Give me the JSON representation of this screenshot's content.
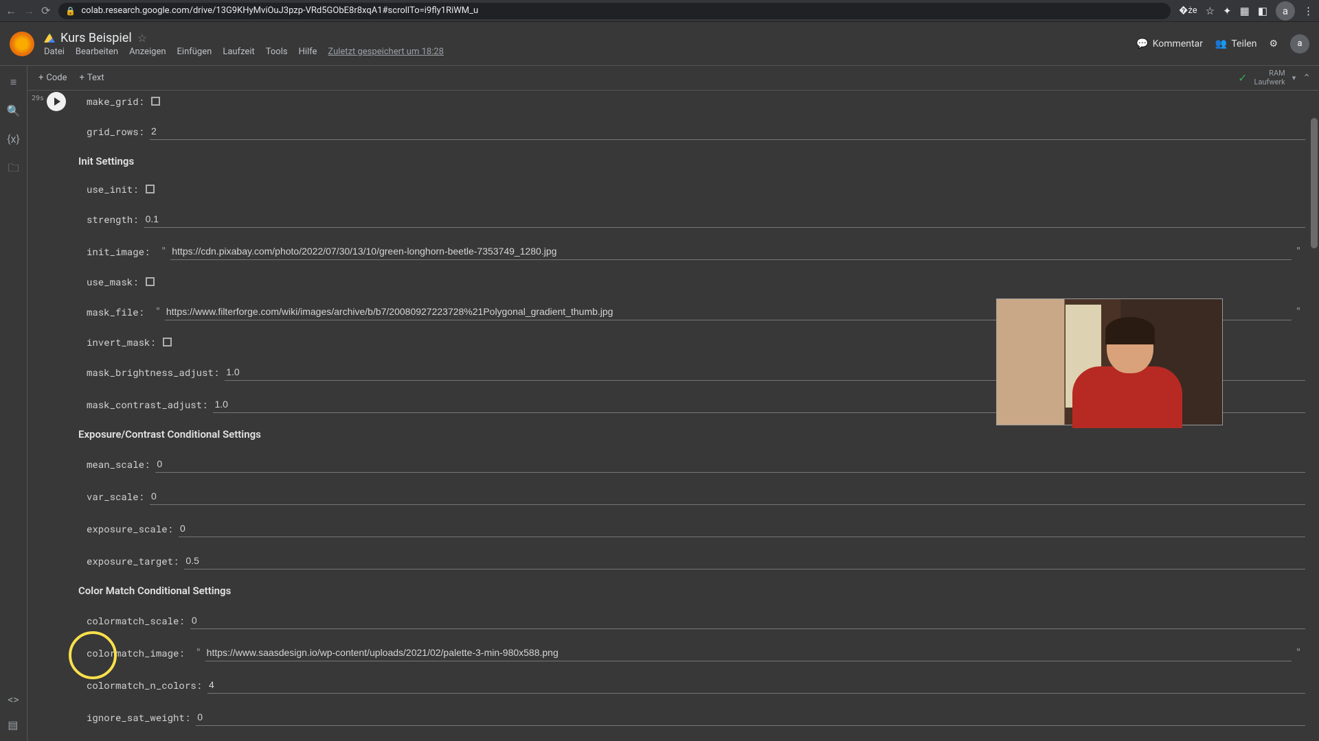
{
  "url": "colab.research.google.com/drive/13G9KHyMviOuJ3pzp-VRd5GObE8r8xqA1#scrollTo=i9fly1RiWM_u",
  "doc_title": "Kurs Beispiel",
  "menu": {
    "file": "Datei",
    "edit": "Bearbeiten",
    "view": "Anzeigen",
    "insert": "Einfügen",
    "runtime": "Laufzeit",
    "tools": "Tools",
    "help": "Hilfe",
    "saved": "Zuletzt gespeichert um 18:28"
  },
  "header_right": {
    "comment": "Kommentar",
    "share": "Teilen"
  },
  "toolbar": {
    "code": "Code",
    "text": "Text",
    "ram": "RAM",
    "disk": "Laufwerk"
  },
  "cell_marker": "29s",
  "sections": {
    "init": "Init Settings",
    "exposure": "Exposure/Contrast Conditional Settings",
    "colormatch": "Color Match Conditional Settings"
  },
  "fields": {
    "make_grid": {
      "label": "make_grid:",
      "checked": false
    },
    "grid_rows": {
      "label": "grid_rows:",
      "value": "2"
    },
    "use_init": {
      "label": "use_init:",
      "checked": false
    },
    "strength": {
      "label": "strength:",
      "value": "0.1"
    },
    "init_image": {
      "label": "init_image:",
      "value": "https://cdn.pixabay.com/photo/2022/07/30/13/10/green-longhorn-beetle-7353749_1280.jpg"
    },
    "use_mask": {
      "label": "use_mask:",
      "checked": false
    },
    "mask_file": {
      "label": "mask_file:",
      "value": "https://www.filterforge.com/wiki/images/archive/b/b7/20080927223728%21Polygonal_gradient_thumb.jpg"
    },
    "invert_mask": {
      "label": "invert_mask:",
      "checked": false
    },
    "mask_brightness_adjust": {
      "label": "mask_brightness_adjust:",
      "value": "1.0"
    },
    "mask_contrast_adjust": {
      "label": "mask_contrast_adjust:",
      "value": "1.0"
    },
    "mean_scale": {
      "label": "mean_scale:",
      "value": "0"
    },
    "var_scale": {
      "label": "var_scale:",
      "value": "0"
    },
    "exposure_scale": {
      "label": "exposure_scale:",
      "value": "0"
    },
    "exposure_target": {
      "label": "exposure_target:",
      "value": "0.5"
    },
    "colormatch_scale": {
      "label": "colormatch_scale:",
      "value": "0"
    },
    "colormatch_image": {
      "label": "colormatch_image:",
      "value": "https://www.saasdesign.io/wp-content/uploads/2021/02/palette-3-min-980x588.png"
    },
    "colormatch_n_colors": {
      "label": "colormatch_n_colors:",
      "value": "4"
    },
    "ignore_sat_weight": {
      "label": "ignore_sat_weight:",
      "value": "0"
    }
  },
  "avatar_letter": "a"
}
